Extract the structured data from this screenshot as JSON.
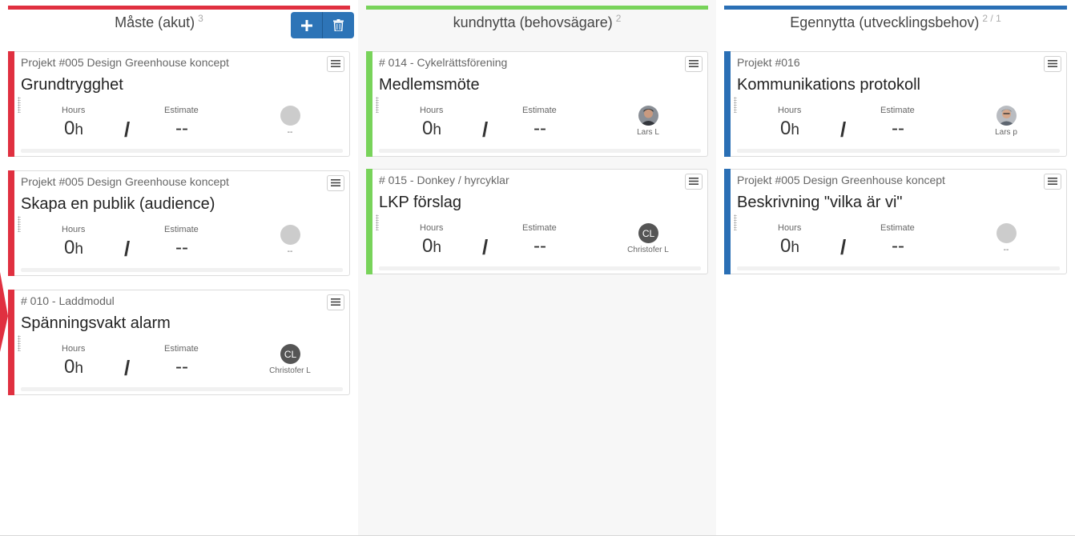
{
  "labels": {
    "hours": "Hours",
    "estimate": "Estimate",
    "hours_unit": "h"
  },
  "columns": [
    {
      "title": "Måste (akut)",
      "count": "3",
      "accent": "#e03040",
      "buttons": {
        "add_icon": "plus-icon",
        "delete_icon": "trash-icon"
      },
      "cards": [
        {
          "project": "Projekt #005 Design Greenhouse koncept",
          "title": "Grundtrygghet",
          "hours": "0",
          "estimate": "--",
          "assignee": "--",
          "avatar": "empty"
        },
        {
          "project": "Projekt #005 Design Greenhouse koncept",
          "title": "Skapa en publik (audience)",
          "hours": "0",
          "estimate": "--",
          "assignee": "--",
          "avatar": "empty"
        },
        {
          "project": "# 010 - Laddmodul",
          "title": "Spänningsvakt alarm",
          "hours": "0",
          "estimate": "--",
          "assignee": "Christofer L",
          "avatar": "initials",
          "initials": "CL"
        }
      ]
    },
    {
      "title": "kundnytta (behovsägare)",
      "count": "2",
      "accent": "#78d35a",
      "cards": [
        {
          "project": "# 014 - Cykelrättsförening",
          "title": "Medlemsmöte",
          "hours": "0",
          "estimate": "--",
          "assignee": "Lars L",
          "avatar": "photo"
        },
        {
          "project": "# 015 - Donkey / hyrcyklar",
          "title": "LKP förslag",
          "hours": "0",
          "estimate": "--",
          "assignee": "Christofer L",
          "avatar": "initials",
          "initials": "CL"
        }
      ]
    },
    {
      "title": "Egennytta (utvecklingsbehov)",
      "count": "2 / 1",
      "accent": "#2a6fb5",
      "cards": [
        {
          "project": "Projekt #016",
          "title": "Kommunikations protokoll",
          "hours": "0",
          "estimate": "--",
          "assignee": "Lars p",
          "avatar": "photo"
        },
        {
          "project": "Projekt #005 Design Greenhouse koncept",
          "title": "Beskrivning \"vilka är vi\"",
          "hours": "0",
          "estimate": "--",
          "assignee": "--",
          "avatar": "empty"
        }
      ]
    }
  ]
}
